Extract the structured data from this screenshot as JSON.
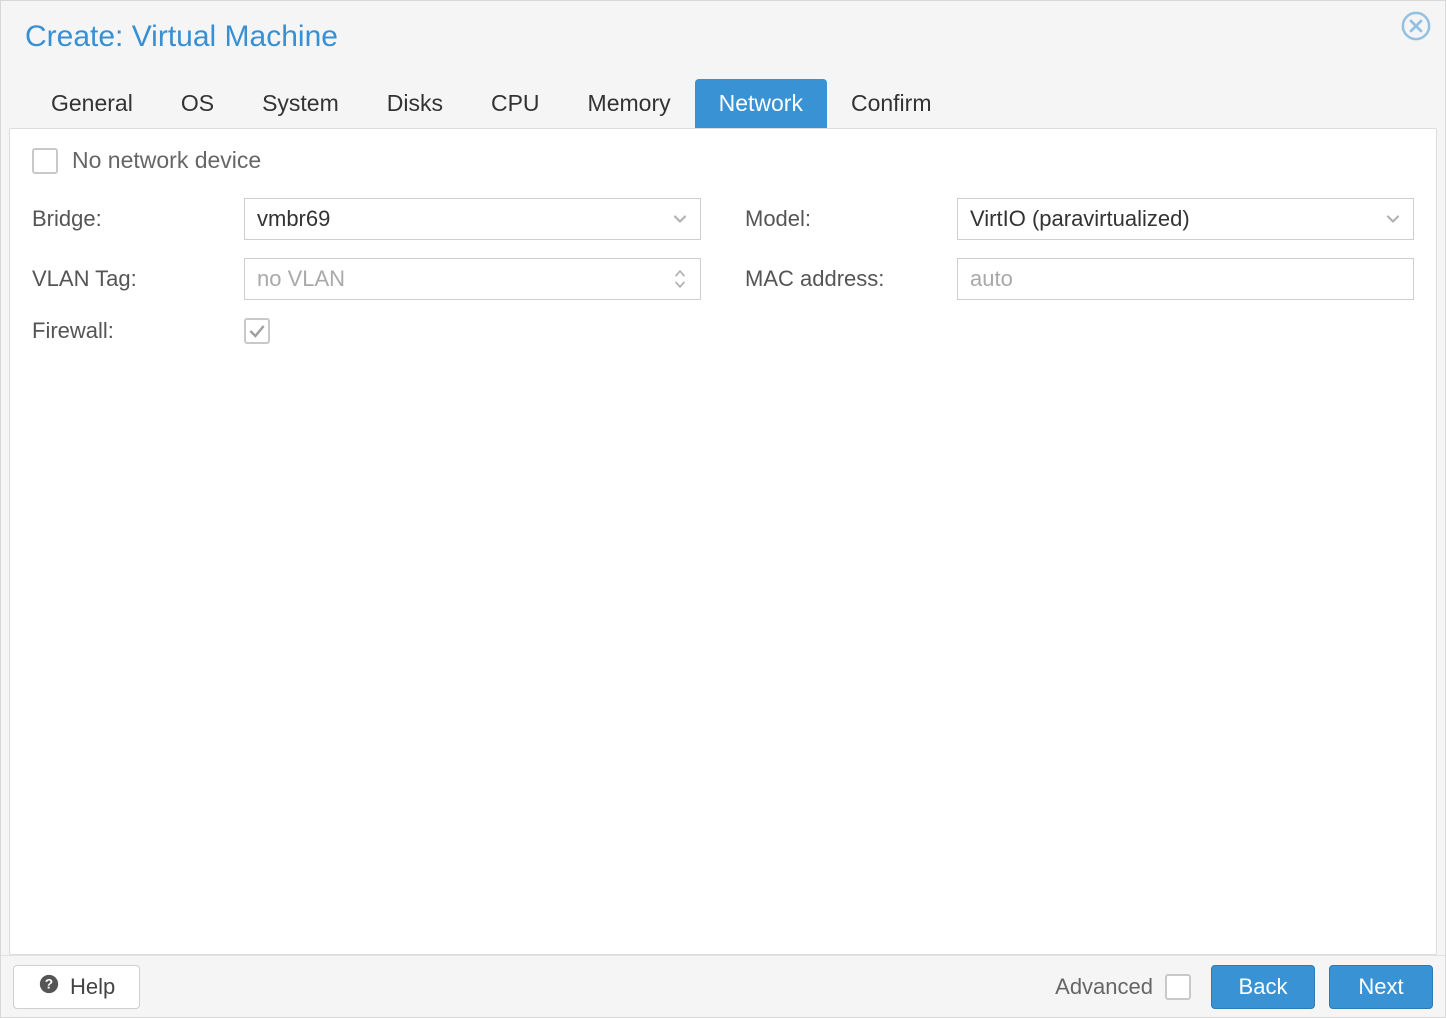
{
  "dialog": {
    "title": "Create: Virtual Machine"
  },
  "tabs": [
    {
      "label": "General",
      "active": false
    },
    {
      "label": "OS",
      "active": false
    },
    {
      "label": "System",
      "active": false
    },
    {
      "label": "Disks",
      "active": false
    },
    {
      "label": "CPU",
      "active": false
    },
    {
      "label": "Memory",
      "active": false
    },
    {
      "label": "Network",
      "active": true
    },
    {
      "label": "Confirm",
      "active": false
    }
  ],
  "network": {
    "no_device_label": "No network device",
    "no_device_checked": false,
    "bridge_label": "Bridge:",
    "bridge_value": "vmbr69",
    "vlan_label": "VLAN Tag:",
    "vlan_placeholder": "no VLAN",
    "firewall_label": "Firewall:",
    "firewall_checked": true,
    "model_label": "Model:",
    "model_value": "VirtIO (paravirtualized)",
    "mac_label": "MAC address:",
    "mac_placeholder": "auto"
  },
  "footer": {
    "help_label": "Help",
    "advanced_label": "Advanced",
    "advanced_checked": false,
    "back_label": "Back",
    "next_label": "Next"
  }
}
